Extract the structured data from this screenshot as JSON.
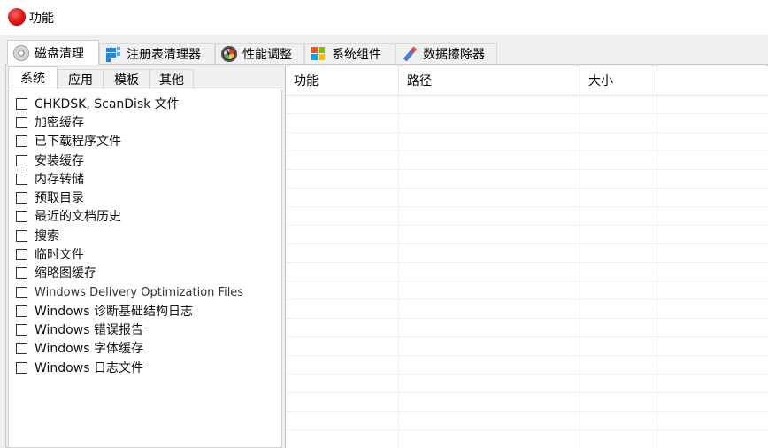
{
  "window": {
    "title": "功能"
  },
  "tabs": [
    {
      "label": "磁盘清理",
      "icon": "disk-icon",
      "active": true
    },
    {
      "label": "注册表清理器",
      "icon": "registry-icon"
    },
    {
      "label": "性能调整",
      "icon": "gauge-icon"
    },
    {
      "label": "系统组件",
      "icon": "windows-icon"
    },
    {
      "label": "数据擦除器",
      "icon": "eraser-icon"
    }
  ],
  "subtabs": [
    {
      "label": "系统",
      "active": true
    },
    {
      "label": "应用"
    },
    {
      "label": "模板"
    },
    {
      "label": "其他"
    }
  ],
  "items": [
    {
      "label": "CHKDSK, ScanDisk 文件",
      "checked": false
    },
    {
      "label": "加密缓存",
      "checked": false
    },
    {
      "label": "已下载程序文件",
      "checked": false
    },
    {
      "label": "安装缓存",
      "checked": false
    },
    {
      "label": "内存转储",
      "checked": false
    },
    {
      "label": "预取目录",
      "checked": false
    },
    {
      "label": "最近的文档历史",
      "checked": false
    },
    {
      "label": "搜索",
      "checked": false
    },
    {
      "label": "临时文件",
      "checked": false
    },
    {
      "label": "缩略图缓存",
      "checked": false
    },
    {
      "label": "Windows Delivery Optimization Files",
      "checked": false
    },
    {
      "label": "Windows 诊断基础结构日志",
      "checked": false
    },
    {
      "label": "Windows 错误报告",
      "checked": false
    },
    {
      "label": "Windows 字体缓存",
      "checked": false
    },
    {
      "label": "Windows 日志文件",
      "checked": false
    }
  ],
  "grid": {
    "columns": [
      "功能",
      "路径",
      "大小"
    ]
  }
}
